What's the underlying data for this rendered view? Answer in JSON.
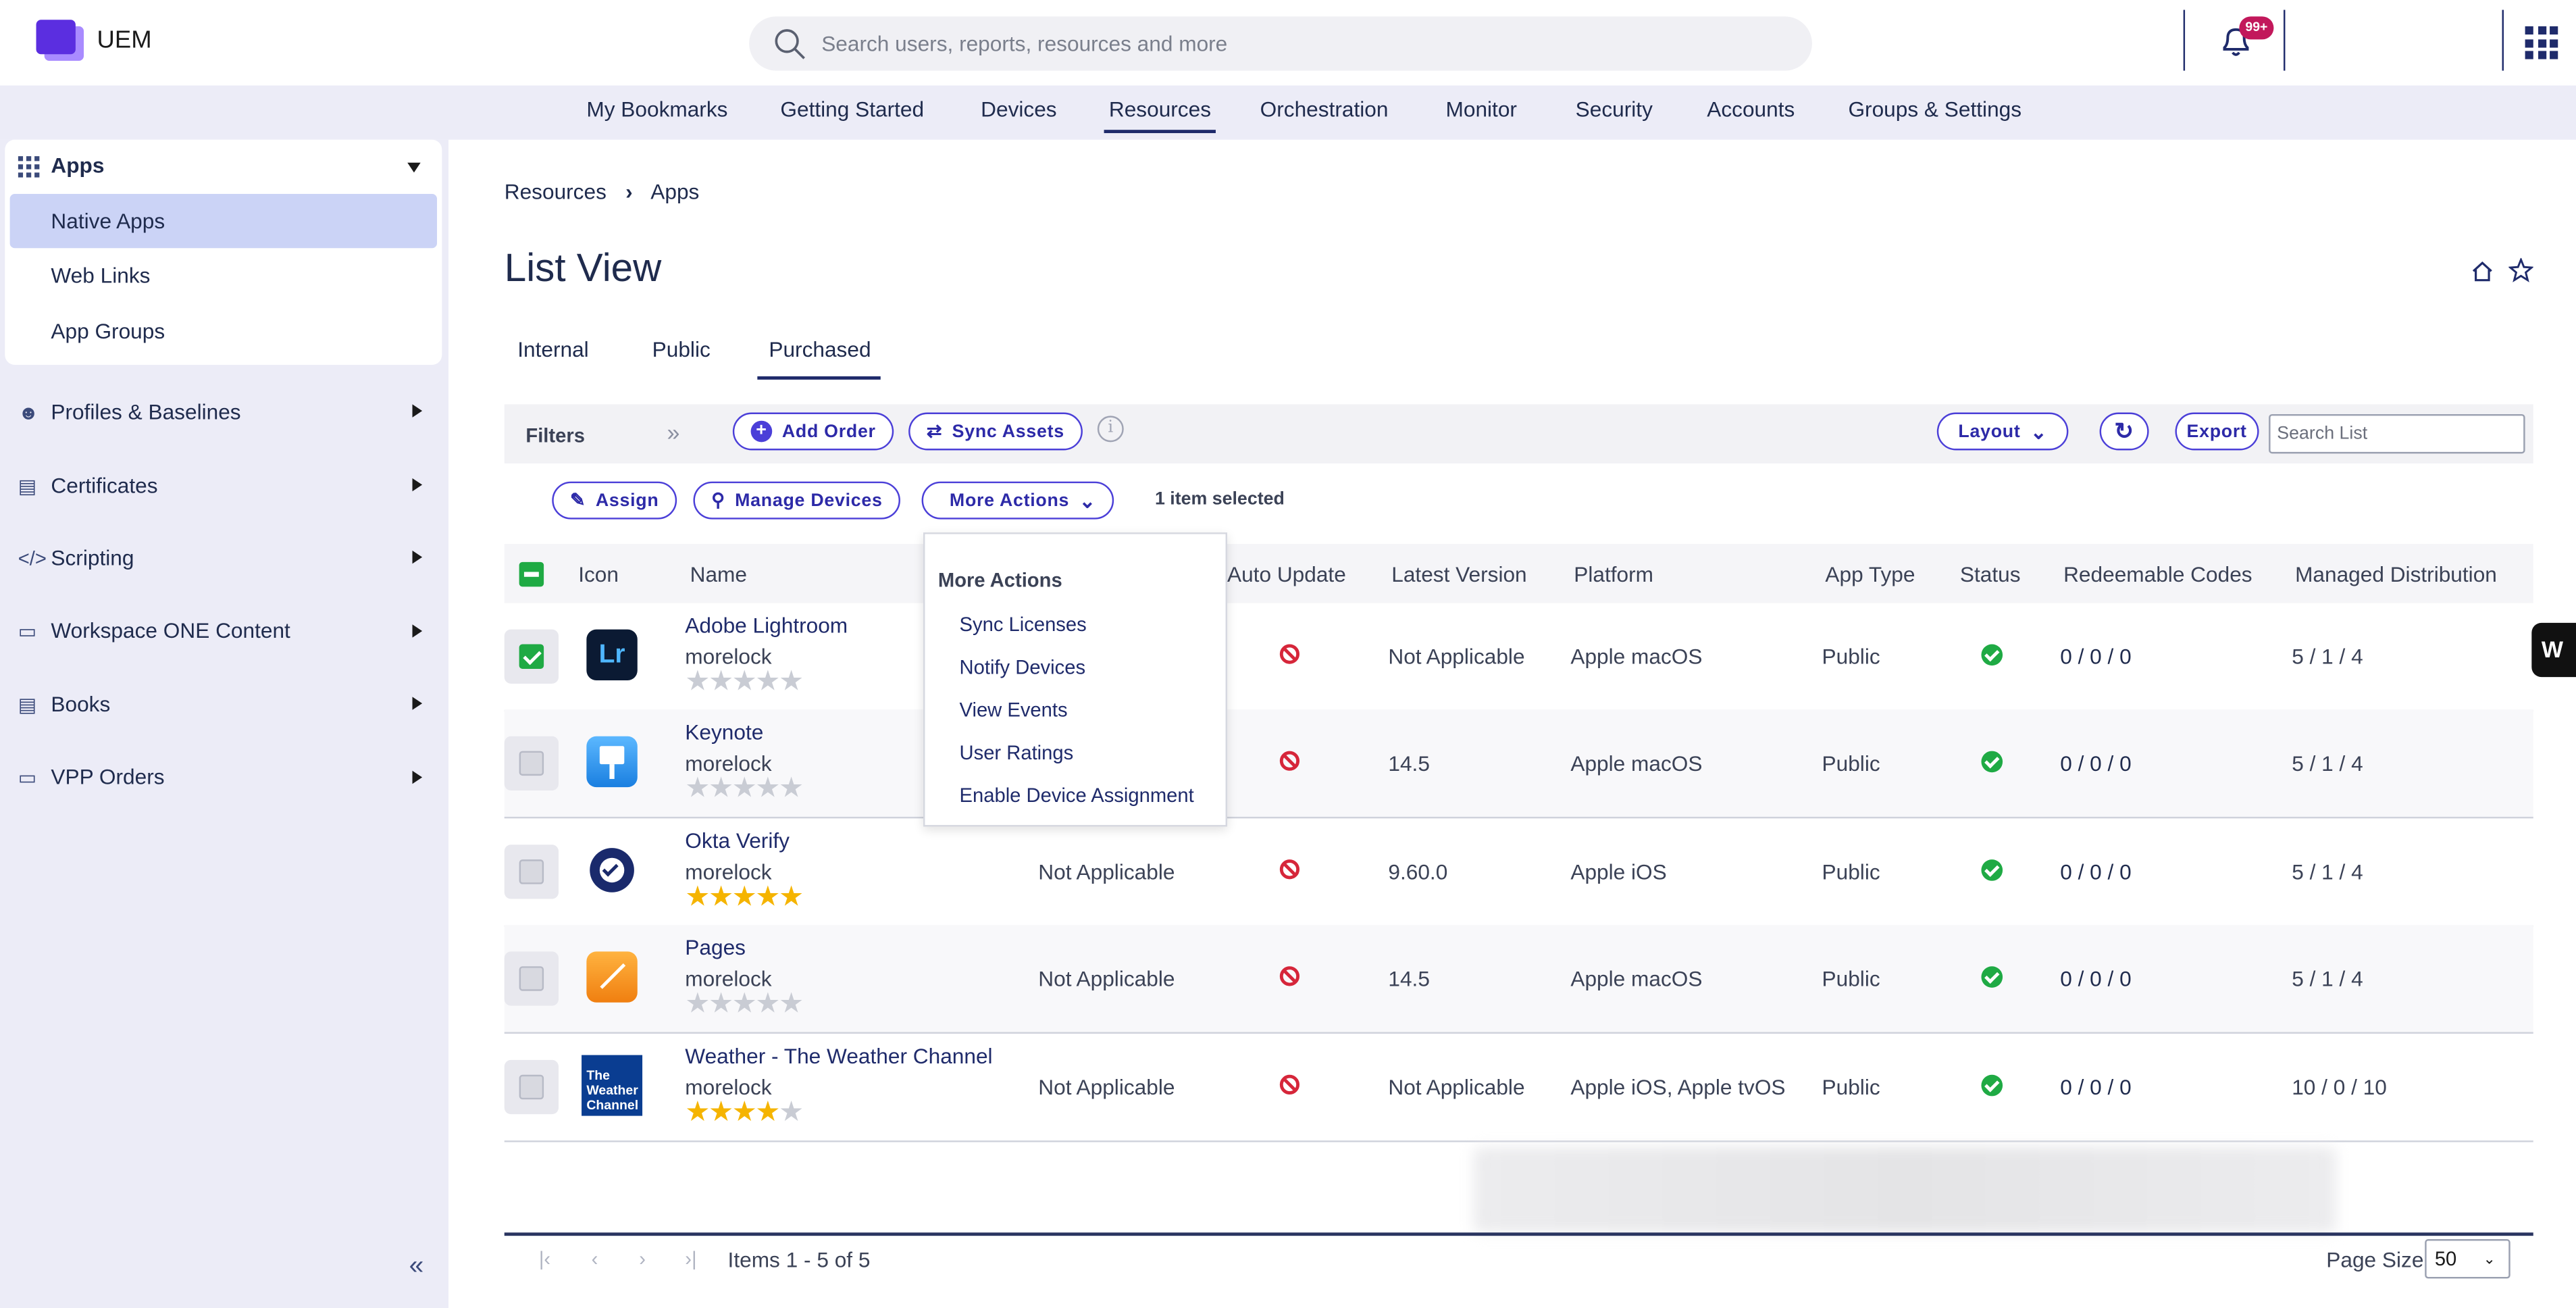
{
  "app": {
    "name": "UEM",
    "notification_count": "99+"
  },
  "search": {
    "placeholder": "Search users, reports, resources and more"
  },
  "nav": {
    "items": [
      "My Bookmarks",
      "Getting Started",
      "Devices",
      "Resources",
      "Orchestration",
      "Monitor",
      "Security",
      "Accounts",
      "Groups & Settings"
    ],
    "active": "Resources"
  },
  "sidebar": {
    "apps": {
      "label": "Apps",
      "items": [
        "Native Apps",
        "Web Links",
        "App Groups"
      ],
      "selected": "Native Apps"
    },
    "sections": [
      "Profiles & Baselines",
      "Certificates",
      "Scripting",
      "Workspace ONE Content",
      "Books",
      "VPP Orders"
    ]
  },
  "breadcrumb": [
    "Resources",
    "Apps"
  ],
  "page": {
    "title": "List View"
  },
  "tabs": [
    "Internal",
    "Public",
    "Purchased"
  ],
  "active_tab": "Purchased",
  "toolbar": {
    "filters": "Filters",
    "add_order": "Add Order",
    "sync_assets": "Sync Assets",
    "layout": "Layout",
    "export": "Export",
    "search_placeholder": "Search List"
  },
  "actions": {
    "assign": "Assign",
    "manage_devices": "Manage Devices",
    "more_actions": "More Actions",
    "selection": "1 item selected"
  },
  "more_menu": {
    "title": "More Actions",
    "items": [
      "Sync Licenses",
      "Notify Devices",
      "View Events",
      "User Ratings",
      "Enable Device Assignment"
    ]
  },
  "table": {
    "headers": {
      "icon": "Icon",
      "name": "Name",
      "auto_update": "Auto Update",
      "latest_version": "Latest Version",
      "platform": "Platform",
      "app_type": "App Type",
      "status": "Status",
      "redeemable": "Redeemable Codes",
      "managed": "Managed Distribution"
    },
    "rows": [
      {
        "name": "Adobe Lightroom",
        "owner": "morelock",
        "rating": 0,
        "col4": "",
        "latest": "Not Applicable",
        "platform": "Apple macOS",
        "type": "Public",
        "redeemable": "0 / 0 / 0",
        "managed": "5 / 1 / 4",
        "selected": true,
        "icon": "lightroom-icon"
      },
      {
        "name": "Keynote",
        "owner": "morelock",
        "rating": 0,
        "col4": "",
        "latest": "14.5",
        "platform": "Apple macOS",
        "type": "Public",
        "redeemable": "0 / 0 / 0",
        "managed": "5 / 1 / 4",
        "selected": false,
        "icon": "keynote-icon"
      },
      {
        "name": "Okta Verify",
        "owner": "morelock",
        "rating": 5,
        "col4": "Not Applicable",
        "latest": "9.60.0",
        "platform": "Apple iOS",
        "type": "Public",
        "redeemable": "0 / 0 / 0",
        "managed": "5 / 1 / 4",
        "selected": false,
        "icon": "okta-icon"
      },
      {
        "name": "Pages",
        "owner": "morelock",
        "rating": 0,
        "col4": "Not Applicable",
        "latest": "14.5",
        "platform": "Apple macOS",
        "type": "Public",
        "redeemable": "0 / 0 / 0",
        "managed": "5 / 1 / 4",
        "selected": false,
        "icon": "pages-icon"
      },
      {
        "name": "Weather - The Weather Channel",
        "owner": "morelock",
        "rating": 4,
        "col4": "Not Applicable",
        "latest": "Not Applicable",
        "platform": "Apple iOS, Apple tvOS",
        "type": "Public",
        "redeemable": "0 / 0 / 0",
        "managed": "10 / 0 / 10",
        "selected": false,
        "icon": "weather-channel-icon",
        "icon_text": "The Weather Channel"
      }
    ]
  },
  "footer": {
    "items": "Items 1 - 5 of 5",
    "page_size_label": "Page Size:",
    "page_size": "50"
  },
  "widget": {
    "label": "W"
  },
  "colors": {
    "accent": "#1f2b6b",
    "pill": "#4b3fd8",
    "success": "#1faa44",
    "danger": "#d6263a",
    "selected_bg": "#cbd3f6"
  }
}
